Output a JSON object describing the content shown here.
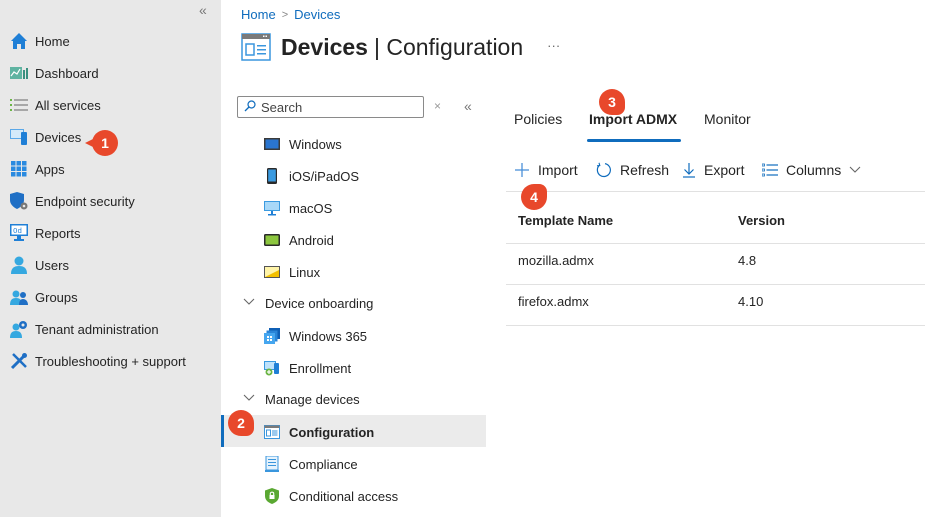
{
  "leftnav": {
    "collapse_icon": "double-chevron-left-icon",
    "items": [
      {
        "label": "Home",
        "icon": "home-icon"
      },
      {
        "label": "Dashboard",
        "icon": "dashboard-icon"
      },
      {
        "label": "All services",
        "icon": "list-icon"
      },
      {
        "label": "Devices",
        "icon": "devices-icon"
      },
      {
        "label": "Apps",
        "icon": "apps-grid-icon"
      },
      {
        "label": "Endpoint security",
        "icon": "shield-gear-icon"
      },
      {
        "label": "Reports",
        "icon": "reports-monitor-icon"
      },
      {
        "label": "Users",
        "icon": "user-icon"
      },
      {
        "label": "Groups",
        "icon": "groups-icon"
      },
      {
        "label": "Tenant administration",
        "icon": "tenant-admin-icon"
      },
      {
        "label": "Troubleshooting + support",
        "icon": "tools-icon"
      }
    ]
  },
  "badges": {
    "b1": "1",
    "b2": "2",
    "b3": "3",
    "b4": "4"
  },
  "breadcrumb": {
    "items": [
      "Home",
      "Devices"
    ],
    "separator": ">"
  },
  "header": {
    "title_bold": "Devices",
    "title_rest": "| Configuration",
    "more": "···"
  },
  "secondary_nav": {
    "search_placeholder": "Search",
    "clear": "×",
    "collapse": "«",
    "platforms": [
      {
        "label": "Windows",
        "icon": "windows-device-icon"
      },
      {
        "label": "iOS/iPadOS",
        "icon": "ios-device-icon"
      },
      {
        "label": "macOS",
        "icon": "macos-monitor-icon"
      },
      {
        "label": "Android",
        "icon": "android-device-icon"
      },
      {
        "label": "Linux",
        "icon": "linux-device-icon"
      }
    ],
    "groups": [
      {
        "label": "Device onboarding",
        "items": [
          {
            "label": "Windows 365",
            "icon": "windows365-icon"
          },
          {
            "label": "Enrollment",
            "icon": "enrollment-icon"
          }
        ]
      },
      {
        "label": "Manage devices",
        "items": [
          {
            "label": "Configuration",
            "icon": "configuration-icon",
            "active": true
          },
          {
            "label": "Compliance",
            "icon": "compliance-icon"
          },
          {
            "label": "Conditional access",
            "icon": "conditional-access-icon"
          }
        ]
      }
    ]
  },
  "tabs": [
    {
      "label": "Policies",
      "active": false
    },
    {
      "label": "Import ADMX",
      "active": true
    },
    {
      "label": "Monitor",
      "active": false
    }
  ],
  "toolbar": {
    "import": "Import",
    "refresh": "Refresh",
    "export": "Export",
    "columns": "Columns"
  },
  "table": {
    "columns": [
      "Template Name",
      "Version"
    ],
    "rows": [
      [
        "mozilla.admx",
        "4.8"
      ],
      [
        "firefox.admx",
        "4.10"
      ]
    ]
  },
  "colors": {
    "accent": "#0f6cbd",
    "badge": "#e8482b",
    "nav_bg": "#e8e8e8"
  }
}
